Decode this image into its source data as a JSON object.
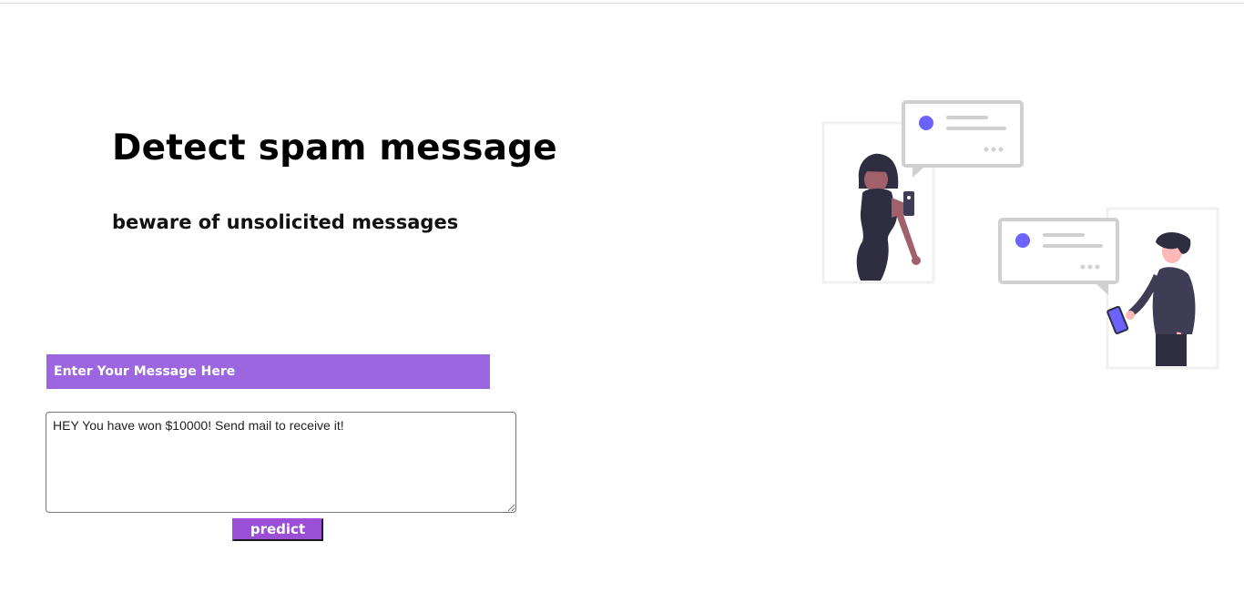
{
  "header": {
    "title": "Detect spam message",
    "subtitle": "beware of unsolicited messages"
  },
  "form": {
    "banner_label": "Enter Your Message Here",
    "message_value": "HEY You have won $10000! Send mail to receive it!",
    "predict_label": "predict"
  },
  "colors": {
    "banner": "#9b66e0",
    "button": "#9b4fd6",
    "accent": "#6c63ff",
    "figure_dark": "#2f2e41",
    "skin_woman": "#a0616a",
    "skin_man": "#ffb8b8"
  },
  "illustration": {
    "icon": "chat-people-illustration"
  }
}
